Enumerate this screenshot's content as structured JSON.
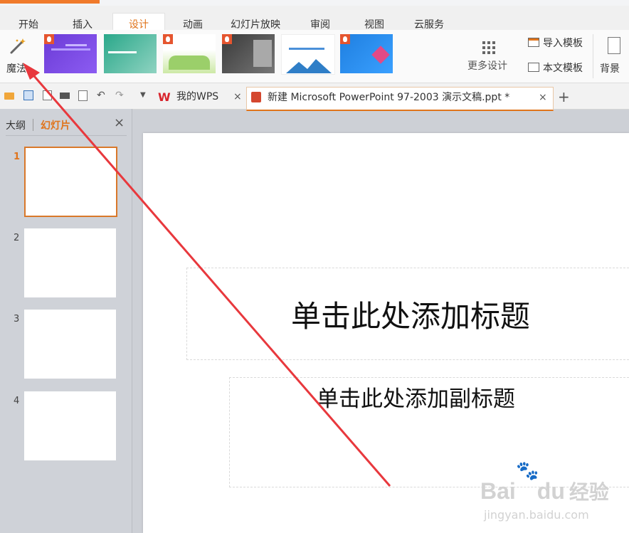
{
  "menu": {
    "tabs": [
      "开始",
      "插入",
      "设计",
      "动画",
      "幻灯片放映",
      "审阅",
      "视图",
      "云服务"
    ],
    "active": "设计"
  },
  "ribbon": {
    "magic_label": "魔法",
    "more_design_label": "更多设计",
    "import_template_label": "导入模板",
    "text_template_label": "本文模板",
    "background_label": "背景"
  },
  "doc_tabs": {
    "wps_label": "我的WPS",
    "file_label": "新建 Microsoft PowerPoint 97-2003 演示文稿.ppt *",
    "add_label": "+"
  },
  "pane": {
    "outline_label": "大纲",
    "slides_label": "幻灯片",
    "close_label": "×",
    "slide_numbers": [
      "1",
      "2",
      "3",
      "4"
    ]
  },
  "slide": {
    "title_placeholder": "单击此处添加标题",
    "subtitle_placeholder": "单击此处添加副标题"
  },
  "watermark": {
    "brand": "Bai",
    "brand2": "du",
    "brand_cn": "经验",
    "url": "jingyan.baidu.com"
  },
  "colors": {
    "accent": "#e0741b",
    "annotation_arrow": "#e8383d",
    "pane_bg": "#cfd2d8"
  }
}
